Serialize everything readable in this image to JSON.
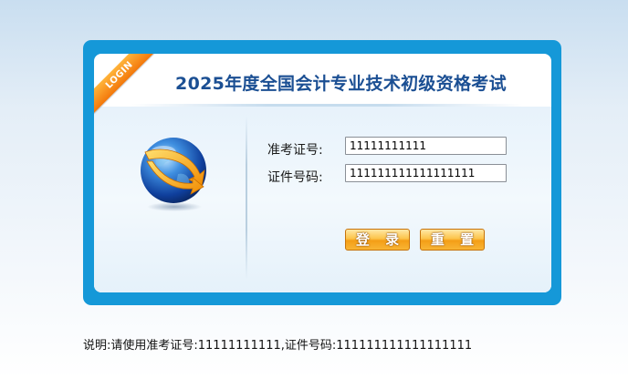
{
  "ribbon": {
    "text": "LOGIN"
  },
  "header": {
    "title": "2025年度全国会计专业技术初级资格考试"
  },
  "form": {
    "admission_label": "准考证号:",
    "admission_value": "11111111111",
    "id_label": "证件号码:",
    "id_value": "111111111111111111",
    "login_button": "登 录",
    "reset_button": "重 置"
  },
  "note": {
    "text": "说明:请使用准考证号:11111111111,证件号码:111111111111111111"
  },
  "colors": {
    "frame": "#1598d8",
    "title": "#1b4f93",
    "button": "#f49e16",
    "ribbon": "#f3780b"
  },
  "icons": {
    "globe": "globe-arrow-icon"
  }
}
